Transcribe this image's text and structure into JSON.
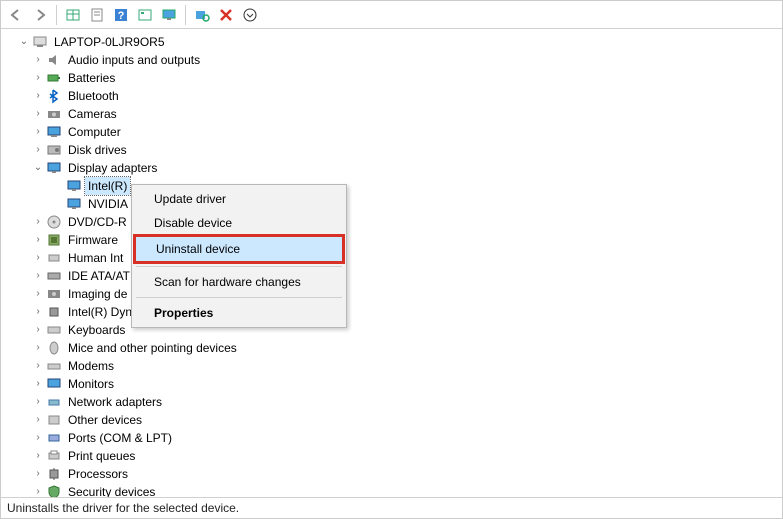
{
  "toolbar": {
    "back": "back-icon",
    "forward": "forward-icon",
    "show_hidden": "show-hidden-icon",
    "properties": "properties-icon",
    "help": "help-icon",
    "details": "details-icon",
    "monitor": "monitor-icon",
    "scan": "scan-icon",
    "remove": "remove-icon",
    "down": "down-icon"
  },
  "root": {
    "label": "LAPTOP-0LJR9OR5",
    "expanded": true
  },
  "categories": [
    {
      "label": "Audio inputs and outputs",
      "expanded": false,
      "icon": "audio"
    },
    {
      "label": "Batteries",
      "expanded": false,
      "icon": "battery"
    },
    {
      "label": "Bluetooth",
      "expanded": false,
      "icon": "bluetooth"
    },
    {
      "label": "Cameras",
      "expanded": false,
      "icon": "camera"
    },
    {
      "label": "Computer",
      "expanded": false,
      "icon": "computer"
    },
    {
      "label": "Disk drives",
      "expanded": false,
      "icon": "disk"
    },
    {
      "label": "Display adapters",
      "expanded": true,
      "icon": "display",
      "children": [
        {
          "label": "Intel(R)",
          "icon": "display",
          "selected": true
        },
        {
          "label": "NVIDIA",
          "icon": "display",
          "selected": false
        }
      ]
    },
    {
      "label": "DVD/CD-R",
      "expanded": false,
      "icon": "dvd",
      "truncated": true
    },
    {
      "label": "Firmware",
      "expanded": false,
      "icon": "firmware",
      "truncated": true
    },
    {
      "label": "Human Int",
      "expanded": false,
      "icon": "hid",
      "truncated": true
    },
    {
      "label": "IDE ATA/AT",
      "expanded": false,
      "icon": "ide",
      "truncated": true
    },
    {
      "label": "Imaging de",
      "expanded": false,
      "icon": "imaging",
      "truncated": true
    },
    {
      "label": "Intel(R) Dynamic Platform and Thermal Framework",
      "expanded": false,
      "icon": "chip"
    },
    {
      "label": "Keyboards",
      "expanded": false,
      "icon": "keyboard"
    },
    {
      "label": "Mice and other pointing devices",
      "expanded": false,
      "icon": "mouse"
    },
    {
      "label": "Modems",
      "expanded": false,
      "icon": "modem"
    },
    {
      "label": "Monitors",
      "expanded": false,
      "icon": "monitor"
    },
    {
      "label": "Network adapters",
      "expanded": false,
      "icon": "network"
    },
    {
      "label": "Other devices",
      "expanded": false,
      "icon": "other"
    },
    {
      "label": "Ports (COM & LPT)",
      "expanded": false,
      "icon": "port"
    },
    {
      "label": "Print queues",
      "expanded": false,
      "icon": "printer"
    },
    {
      "label": "Processors",
      "expanded": false,
      "icon": "cpu"
    },
    {
      "label": "Security devices",
      "expanded": false,
      "icon": "security"
    }
  ],
  "context_menu": {
    "items": [
      {
        "label": "Update driver",
        "type": "item"
      },
      {
        "label": "Disable device",
        "type": "item"
      },
      {
        "label": "Uninstall device",
        "type": "item",
        "highlighted": true
      },
      {
        "type": "separator"
      },
      {
        "label": "Scan for hardware changes",
        "type": "item"
      },
      {
        "type": "separator"
      },
      {
        "label": "Properties",
        "type": "item",
        "bold": true
      }
    ]
  },
  "status_bar": "Uninstalls the driver for the selected device."
}
